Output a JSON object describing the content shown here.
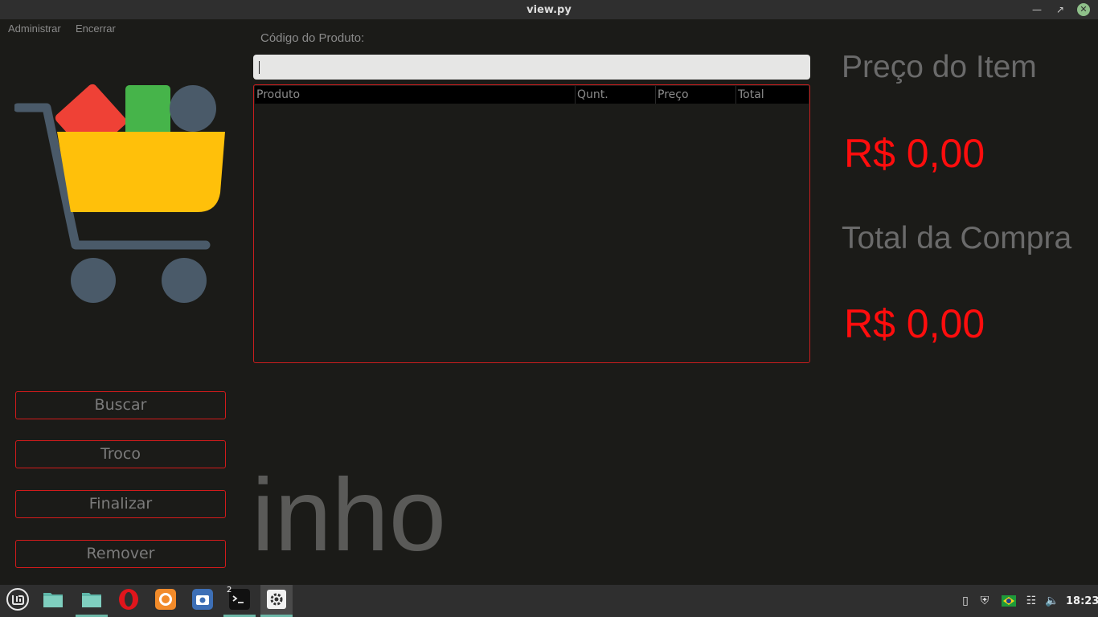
{
  "window": {
    "title": "view.py",
    "minimize_icon": "minimize-icon",
    "maximize_icon": "maximize-icon",
    "close_icon": "close-icon"
  },
  "menu": {
    "items": [
      "Administrar",
      "Encerrar"
    ]
  },
  "logo": {
    "icon": "shopping-cart-icon"
  },
  "sidebar": {
    "buttons": [
      "Buscar",
      "Troco",
      "Finalizar",
      "Remover"
    ]
  },
  "product_code": {
    "label": "Código do Produto:",
    "value": ""
  },
  "table": {
    "columns": [
      "Produto",
      "Qunt.",
      "Preço",
      "Total"
    ],
    "rows": []
  },
  "summary": {
    "item_price_label": "Preço do Item",
    "item_price_value": "R$ 0,00",
    "total_label": "Total da Compra",
    "total_value": "R$ 0,00"
  },
  "watermark_text": "inho",
  "taskbar": {
    "apps": [
      "mint-menu-icon",
      "folder-icon",
      "files-icon",
      "opera-icon",
      "firefox-icon",
      "screenshot-icon",
      "terminal-icon",
      "settings-icon"
    ],
    "terminal_badge": "2",
    "tray": [
      "update-icon",
      "shield-icon",
      "flag-icon",
      "network-icon",
      "volume-icon"
    ],
    "clock": "18:23"
  },
  "colors": {
    "accent_red": "#ff0d0d",
    "border_red": "#d21b1b",
    "background": "#1b1b18"
  }
}
